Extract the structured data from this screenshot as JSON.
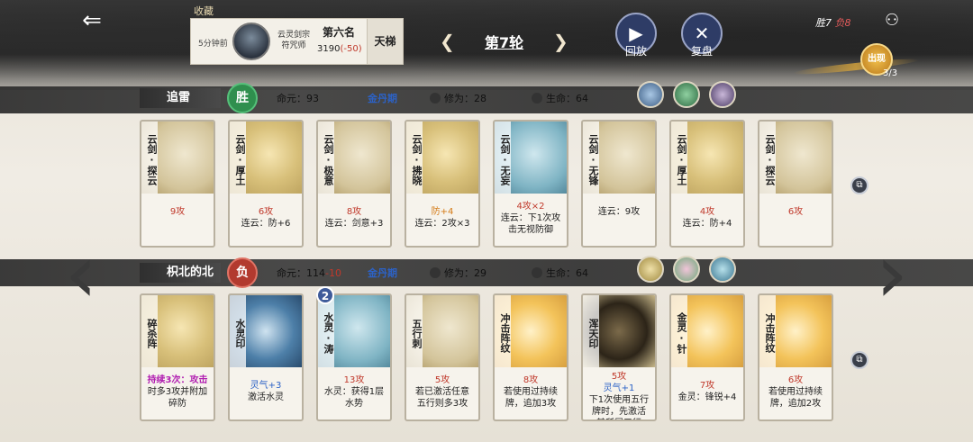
{
  "header": {
    "collect_label": "收藏",
    "recent_match": {
      "time": "5分钟前",
      "sect_line1": "云灵剑宗",
      "sect_line2": "符咒师",
      "rank": "第六名",
      "score": "3190",
      "score_delta": "(-50)",
      "mode": "天梯"
    },
    "round_title": "第7轮",
    "replay_label": "回放",
    "review_label": "复盘",
    "record_win": "胜7",
    "record_lose": "负8",
    "play_badge": "出现",
    "play_count": "3/3"
  },
  "players": [
    {
      "name": "追雷",
      "result": "胜",
      "life_core_label": "命元：",
      "life_core": "93",
      "life_core_delta": "",
      "realm": "金丹期",
      "cultivation_label": "修为：",
      "cultivation": "28",
      "hp_label": "生命：",
      "hp": "64",
      "cards": [
        {
          "tag": "云剑·探云",
          "art": "art-sword",
          "lines": [
            {
              "t": "9攻",
              "c": "r"
            }
          ]
        },
        {
          "tag": "云剑·厚土",
          "art": "art-gold",
          "lines": [
            {
              "t": "6攻",
              "c": "r"
            },
            {
              "t": "连云：防+6",
              "c": ""
            }
          ]
        },
        {
          "tag": "云剑·极意",
          "art": "art-sword",
          "lines": [
            {
              "t": "8攻",
              "c": "r"
            },
            {
              "t": "连云：剑意+3",
              "c": ""
            }
          ]
        },
        {
          "tag": "云剑·拂晓",
          "art": "art-gold",
          "lines": [
            {
              "t": "防+4",
              "c": "o"
            },
            {
              "t": "连云：2攻×3",
              "c": ""
            }
          ]
        },
        {
          "tag": "云剑·无妄",
          "art": "art-cyan",
          "lines": [
            {
              "t": "4攻×2",
              "c": "r"
            },
            {
              "t": "连云：下1次攻",
              "c": ""
            },
            {
              "t": "击无视防御",
              "c": ""
            }
          ]
        },
        {
          "tag": "云剑·无锋",
          "art": "art-sword",
          "lines": [
            {
              "t": "连云：9攻",
              "c": ""
            }
          ]
        },
        {
          "tag": "云剑·厚土",
          "art": "art-gold",
          "lines": [
            {
              "t": "4攻",
              "c": "r"
            },
            {
              "t": "连云：防+4",
              "c": ""
            }
          ]
        },
        {
          "tag": "云剑·探云",
          "art": "art-sword",
          "lines": [
            {
              "t": "6攻",
              "c": "r"
            }
          ]
        }
      ]
    },
    {
      "name": "枳北的北",
      "result": "负",
      "life_core_label": "命元：",
      "life_core": "114",
      "life_core_delta": "-10",
      "realm": "金丹期",
      "cultivation_label": "修为：",
      "cultivation": "29",
      "hp_label": "生命：",
      "hp": "64",
      "cards": [
        {
          "tag": "碎杀阵",
          "art": "art-gold",
          "level": "",
          "lines": [
            {
              "t": "持续3次：攻击",
              "c": "p"
            },
            {
              "t": "时多3攻并附加",
              "c": ""
            },
            {
              "t": "碎防",
              "c": ""
            }
          ]
        },
        {
          "tag": "水灵印",
          "art": "art-blue-seal",
          "level": "",
          "lines": [
            {
              "t": "灵气+3",
              "c": "b"
            },
            {
              "t": "激活水灵",
              "c": ""
            }
          ]
        },
        {
          "tag": "水灵·涛",
          "art": "art-cyan",
          "level": "2",
          "lines": [
            {
              "t": "13攻",
              "c": "r"
            },
            {
              "t": "水灵：获得1层",
              "c": ""
            },
            {
              "t": "水势",
              "c": ""
            }
          ]
        },
        {
          "tag": "五行刺",
          "art": "art-sword",
          "level": "",
          "lines": [
            {
              "t": "5攻",
              "c": "r"
            },
            {
              "t": "若已激活任意",
              "c": ""
            },
            {
              "t": "五行则多3攻",
              "c": ""
            }
          ]
        },
        {
          "tag": "冲击阵纹",
          "art": "art-flame",
          "level": "",
          "lines": [
            {
              "t": "8攻",
              "c": "r"
            },
            {
              "t": "若使用过持续",
              "c": ""
            },
            {
              "t": "牌，追加3攻",
              "c": ""
            }
          ]
        },
        {
          "tag": "浑天印",
          "art": "art-dark-seal",
          "level": "",
          "lines": [
            {
              "t": "5攻",
              "c": "r"
            },
            {
              "t": "灵气+1",
              "c": "b"
            },
            {
              "t": "下1次使用五行",
              "c": ""
            },
            {
              "t": "牌时，先激活",
              "c": ""
            },
            {
              "t": "其所属五行",
              "c": ""
            }
          ]
        },
        {
          "tag": "金灵·针",
          "art": "art-flame",
          "level": "",
          "lines": [
            {
              "t": "7攻",
              "c": "r"
            },
            {
              "t": "金灵：锋锐+4",
              "c": ""
            }
          ]
        },
        {
          "tag": "冲击阵纹",
          "art": "art-flame",
          "level": "",
          "lines": [
            {
              "t": "6攻",
              "c": "r"
            },
            {
              "t": "若使用过持续",
              "c": ""
            },
            {
              "t": "牌，追加2攻",
              "c": ""
            }
          ]
        }
      ]
    }
  ],
  "icons": {
    "back": "back-arrow-icon",
    "replay": "play-icon",
    "review": "swords-icon",
    "share": "share-icon",
    "prev_round": "chevron-left-icon",
    "next_round": "chevron-right-icon",
    "prev_page": "big-chevron-left-icon",
    "next_page": "big-chevron-right-icon",
    "card_detail": "card-detail-icon"
  },
  "colors": {
    "win": "#2f8f4e",
    "lose": "#b23a2f",
    "attack": "#c0392b",
    "qi": "#2c62c6",
    "realm": "#2c62c6"
  }
}
